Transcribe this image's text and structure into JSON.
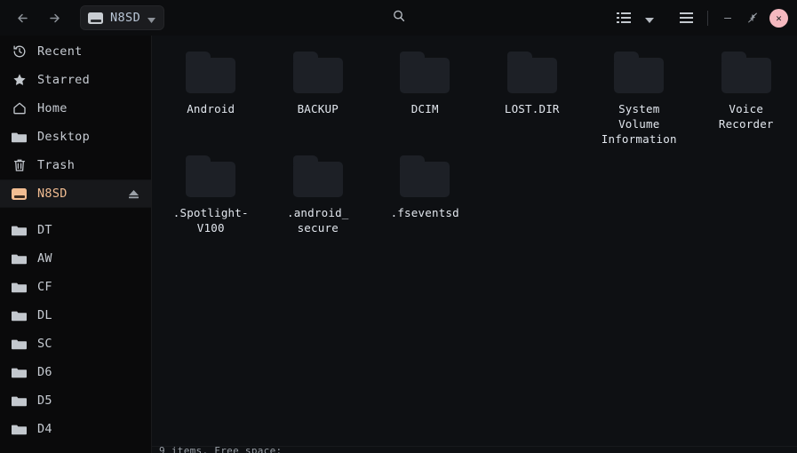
{
  "titlebar": {
    "back_icon": "arrow-left-icon",
    "forward_icon": "arrow-right-icon",
    "breadcrumb": {
      "label": "N8SD",
      "icon": "drive-icon",
      "chevron": "chevron-down-icon"
    },
    "search_icon": "search-icon",
    "view_icon": "list-view-icon",
    "view_chevron": "chevron-down-icon",
    "menu_icon": "hamburger-menu-icon",
    "minimize_label": "–",
    "maximize_label": "⤡",
    "close_label": "✕"
  },
  "sidebar": {
    "items": [
      {
        "label": "Recent",
        "icon": "clock-icon",
        "active": false
      },
      {
        "label": "Starred",
        "icon": "star-icon",
        "active": false
      },
      {
        "label": "Home",
        "icon": "home-icon",
        "active": false
      },
      {
        "label": "Desktop",
        "icon": "folder-icon",
        "active": false
      },
      {
        "label": "Trash",
        "icon": "trash-icon",
        "active": false
      }
    ],
    "device": {
      "label": "N8SD",
      "icon": "drive-icon",
      "eject_icon": "eject-icon",
      "active": true
    },
    "bookmarks": [
      {
        "label": "DT",
        "icon": "folder-icon"
      },
      {
        "label": "AW",
        "icon": "folder-icon"
      },
      {
        "label": "CF",
        "icon": "folder-icon"
      },
      {
        "label": "DL",
        "icon": "folder-icon"
      },
      {
        "label": "SC",
        "icon": "folder-icon"
      },
      {
        "label": "D6",
        "icon": "folder-icon"
      },
      {
        "label": "D5",
        "icon": "folder-icon"
      },
      {
        "label": "D4",
        "icon": "folder-icon"
      }
    ]
  },
  "main": {
    "files": [
      {
        "name": "Android",
        "icon": "folder-icon"
      },
      {
        "name": "BACKUP",
        "icon": "folder-icon"
      },
      {
        "name": "DCIM",
        "icon": "folder-icon"
      },
      {
        "name": "LOST.DIR",
        "icon": "folder-icon"
      },
      {
        "name": "System\nVolume\nInformation",
        "icon": "folder-icon"
      },
      {
        "name": "Voice\nRecorder",
        "icon": "folder-icon"
      },
      {
        "name": ".Spotlight-\nV100",
        "icon": "folder-icon"
      },
      {
        "name": ".android_\nsecure",
        "icon": "folder-icon"
      },
      {
        "name": ".fseventsd",
        "icon": "folder-icon"
      }
    ]
  },
  "statusbar": {
    "text": "9 items, Free space:"
  },
  "colors": {
    "titlebar_bg": "#0c0d0f",
    "sidebar_bg": "#0a0a0b",
    "main_bg": "#0e1013",
    "accent": "#f2bd92",
    "folder": "#1d2026",
    "close_button": "#f4b8bf",
    "text": "#d8dde3"
  }
}
